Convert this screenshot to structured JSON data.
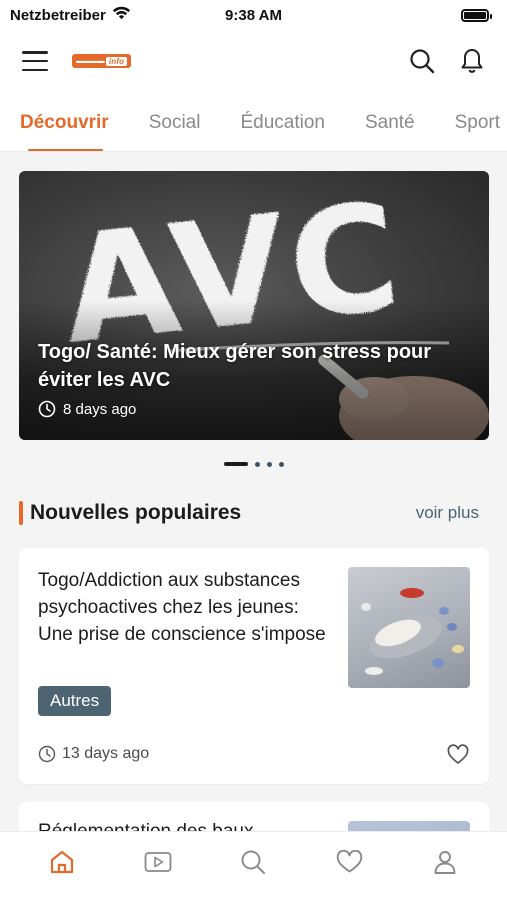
{
  "status_bar": {
    "carrier": "Netzbetreiber",
    "time": "9:38 AM",
    "battery_level": 1.0
  },
  "header": {
    "logo_icon": "brand-logo",
    "icons": [
      "menu-icon",
      "search-icon",
      "bell-icon"
    ]
  },
  "tabs": [
    {
      "label": "Découvrir",
      "active": true
    },
    {
      "label": "Social",
      "active": false
    },
    {
      "label": "Éducation",
      "active": false
    },
    {
      "label": "Santé",
      "active": false
    },
    {
      "label": "Sport",
      "active": false
    }
  ],
  "hero": {
    "image_text": "AVC",
    "title": "Togo/ Santé: Mieux gérer son stress pour éviter les AVC",
    "time_ago": "8 days ago",
    "carousel": {
      "count": 4,
      "active_index": 0
    }
  },
  "popular": {
    "title": "Nouvelles populaires",
    "see_more": "voir plus"
  },
  "articles": [
    {
      "title": "Togo/Addiction aux substances psychoactives chez les jeunes: Une prise de conscience s'impose",
      "tag": "Autres",
      "time_ago": "13 days ago"
    },
    {
      "title": "Réglementation des baux"
    }
  ],
  "bottom_nav": [
    {
      "icon": "home-icon",
      "active": true
    },
    {
      "icon": "video-icon",
      "active": false
    },
    {
      "icon": "search-icon",
      "active": false
    },
    {
      "icon": "heart-icon",
      "active": false
    },
    {
      "icon": "profile-icon",
      "active": false
    }
  ],
  "colors": {
    "accent": "#e4692b",
    "tag_bg": "#4d6472",
    "text": "#1c1c1e",
    "muted": "#8a8a8e",
    "background": "#f4f4f5"
  }
}
